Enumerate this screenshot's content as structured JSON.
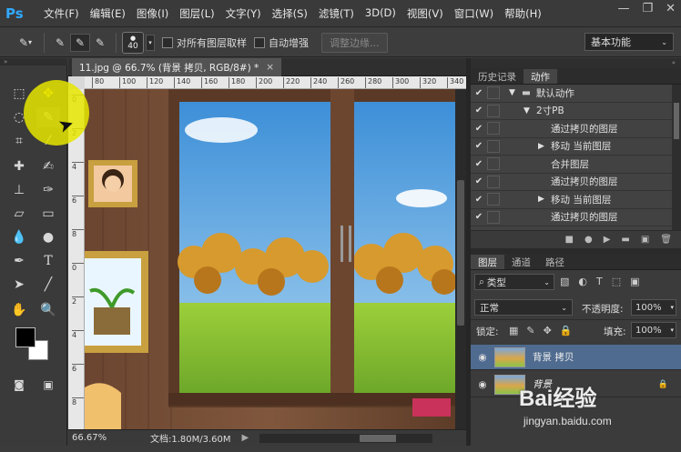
{
  "app": {
    "logo": "Ps"
  },
  "menu": [
    "文件(F)",
    "编辑(E)",
    "图像(I)",
    "图层(L)",
    "文字(Y)",
    "选择(S)",
    "滤镜(T)",
    "3D(D)",
    "视图(V)",
    "窗口(W)",
    "帮助(H)"
  ],
  "options": {
    "brush_size": "40",
    "sample_all_layers": "对所有图层取样",
    "auto_enhance": "自动增强",
    "refine_edge": "调整边缘...",
    "workspace": "基本功能"
  },
  "document": {
    "tab_title": "11.jpg @ 66.7% (背景 拷贝, RGB/8#) *",
    "zoom": "66.67%",
    "doc_size": "文档:1.80M/3.60M",
    "ruler_h": [
      "80",
      "100",
      "120",
      "140",
      "160",
      "180",
      "200",
      "220",
      "240",
      "260",
      "280",
      "300",
      "320",
      "340"
    ],
    "ruler_v": [
      "0",
      "2",
      "4",
      "6",
      "8",
      "0",
      "2",
      "4",
      "6",
      "8"
    ]
  },
  "actions_panel": {
    "tabs": [
      "历史记录",
      "动作"
    ],
    "active_tab": "动作",
    "rows": [
      {
        "label": "默认动作",
        "level": 0,
        "expander": "▼",
        "folder": true
      },
      {
        "label": "2寸PB",
        "level": 1,
        "expander": "▼",
        "folder": false
      },
      {
        "label": "通过拷贝的图层",
        "level": 2,
        "expander": "",
        "folder": false
      },
      {
        "label": "移动 当前图层",
        "level": 2,
        "expander": "▶",
        "folder": false
      },
      {
        "label": "合并图层",
        "level": 2,
        "expander": "",
        "folder": false
      },
      {
        "label": "通过拷贝的图层",
        "level": 2,
        "expander": "",
        "folder": false
      },
      {
        "label": "移动 当前图层",
        "level": 2,
        "expander": "▶",
        "folder": false
      },
      {
        "label": "通过拷贝的图层",
        "level": 2,
        "expander": "",
        "folder": false
      }
    ]
  },
  "layers_panel": {
    "tabs": [
      "图层",
      "通道",
      "路径"
    ],
    "active_tab": "图层",
    "filter": "类型",
    "blend_mode": "正常",
    "opacity_label": "不透明度:",
    "opacity": "100%",
    "lock_label": "锁定:",
    "fill_label": "填充:",
    "fill": "100%",
    "layers": [
      {
        "name": "背景 拷贝",
        "selected": true
      },
      {
        "name": "背景",
        "selected": false
      }
    ]
  },
  "watermark": {
    "text": "Bai经验",
    "url": "jingyan.baidu.com"
  },
  "colors": {
    "highlight": "#e6e600",
    "selection": "#4f6b8f",
    "ps_blue": "#31a8ff"
  }
}
